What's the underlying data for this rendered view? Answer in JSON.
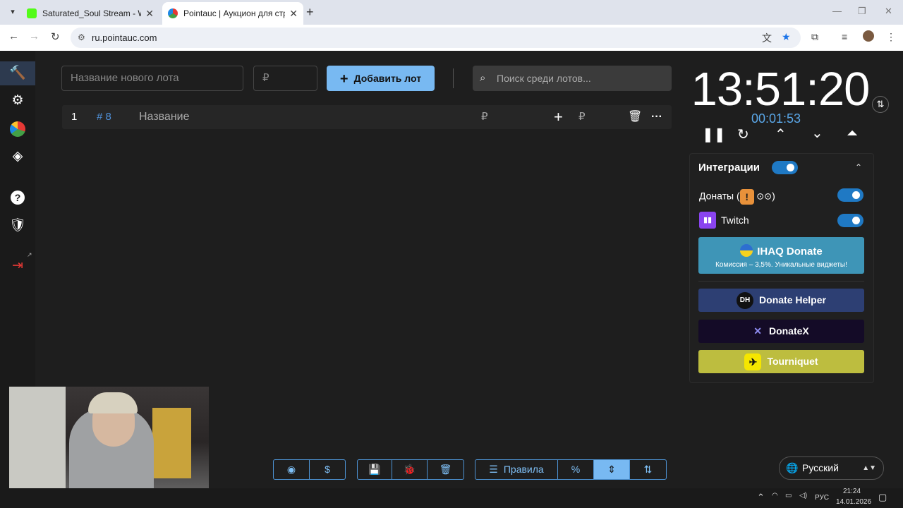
{
  "browser": {
    "tabs": [
      {
        "title": "Saturated_Soul Stream - Watch",
        "active": false,
        "favicon_color": "#53fc18"
      },
      {
        "title": "Pointauc | Аукцион для стриме",
        "active": true,
        "favicon_color": "#e53935"
      }
    ],
    "url": "ru.pointauc.com"
  },
  "sidebar": {
    "items": [
      "hammer-icon",
      "gear-icon",
      "pie-chart-icon",
      "layers-icon",
      "help-icon",
      "shield-check-icon",
      "logout-icon"
    ]
  },
  "controls": {
    "lot_name_placeholder": "Название нового лота",
    "price_placeholder": "₽",
    "add_lot_label": "Добавить лот",
    "search_placeholder": "Поиск среди лотов..."
  },
  "lots": [
    {
      "index": "1",
      "id": "# 8",
      "name_placeholder": "Название",
      "amount_placeholder": "₽",
      "add_amount_placeholder": "₽"
    }
  ],
  "timer": {
    "main": "13:51:20",
    "sub": "00:01:53"
  },
  "integrations": {
    "title": "Интеграции",
    "enabled": true,
    "donations_label": "Донаты (",
    "donations_suffix": ")",
    "twitch_label": "Twitch",
    "ihaq_title": "IHAQ Donate",
    "ihaq_subtitle": "Комиссия – 3,5%. Уникальные виджеты!",
    "donate_helper": "Donate Helper",
    "donatex": "DonateX",
    "tourniquet": "Tourniquet",
    "colors": {
      "toggle": "#1f79c4",
      "ihaq": "#3e95b7",
      "donate_helper": "#2d3f73",
      "donatex": "#140b27",
      "tourniquet": "#bdbd3f"
    }
  },
  "bottom_bar": {
    "rules_label": "Правила"
  },
  "language": "Русский",
  "taskbar": {
    "lang": "РУС",
    "time": "21:24",
    "date": "14.01.2026"
  }
}
